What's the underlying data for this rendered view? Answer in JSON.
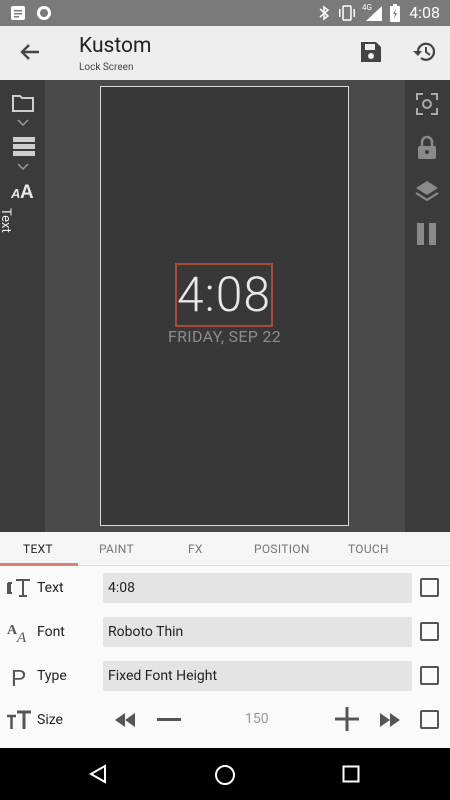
{
  "status_bar": {
    "time": "4:08",
    "network": "4G"
  },
  "app_bar": {
    "title": "Kustom",
    "subtitle": "Lock Screen"
  },
  "editor": {
    "left_toolbar_label": "Text",
    "preview": {
      "clock": "4:08",
      "date": "FRIDAY, SEP 22"
    }
  },
  "tabs": [
    {
      "label": "TEXT",
      "active": true
    },
    {
      "label": "PAINT",
      "active": false
    },
    {
      "label": "FX",
      "active": false
    },
    {
      "label": "POSITION",
      "active": false
    },
    {
      "label": "TOUCH",
      "active": false
    }
  ],
  "properties": {
    "text": {
      "label": "Text",
      "value": "4:08"
    },
    "font": {
      "label": "Font",
      "value": "Roboto Thin"
    },
    "type": {
      "label": "Type",
      "value": "Fixed Font Height"
    },
    "size": {
      "label": "Size",
      "value": "150"
    }
  },
  "colors": {
    "accent": "#d9836c",
    "selection_border": "#a84a35"
  }
}
